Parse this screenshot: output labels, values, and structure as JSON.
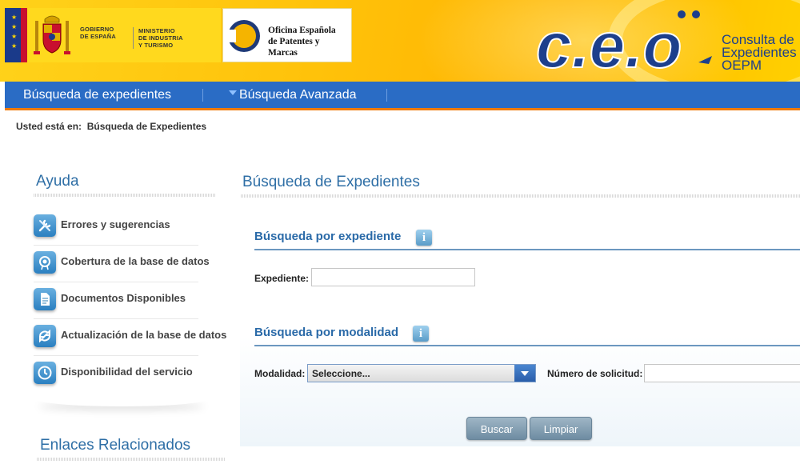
{
  "header": {
    "gov_lines": [
      "GOBIERNO",
      "DE ESPAÑA"
    ],
    "ministry_lines": [
      "MINISTERIO",
      "DE INDUSTRIA",
      "Y TURISMO"
    ],
    "oepm_lines": [
      "Oficina Española",
      "de Patentes y Marcas"
    ],
    "ceo_logo_text": "c.e.o",
    "ceo_sub_lines": [
      "Consulta de",
      "Expedientes",
      "OEPM"
    ],
    "colors": {
      "yellow": "#ffc20a",
      "blue": "#1d3f8c",
      "nav": "#2a6cc5",
      "accent": "#f07a0a"
    }
  },
  "nav": {
    "items": [
      {
        "label": "Búsqueda de expedientes"
      },
      {
        "label": "Búsqueda Avanzada"
      }
    ]
  },
  "breadcrumb": {
    "prefix": "Usted está en:",
    "current": "Búsqueda de Expedientes"
  },
  "sidebar": {
    "title": "Ayuda",
    "items": [
      {
        "label": "Errores y sugerencias",
        "icon": "tools-icon"
      },
      {
        "label": "Cobertura de la base de datos",
        "icon": "coverage-icon"
      },
      {
        "label": "Documentos Disponibles",
        "icon": "document-icon"
      },
      {
        "label": "Actualización de la base de datos",
        "icon": "refresh-icon"
      },
      {
        "label": "Disponibilidad del servicio",
        "icon": "clock-icon"
      }
    ],
    "links_title": "Enlaces Relacionados"
  },
  "main": {
    "title": "Búsqueda de Expedientes",
    "section_expediente": {
      "title": "Búsqueda por expediente",
      "field_label": "Expediente:",
      "field_value": ""
    },
    "section_modalidad": {
      "title": "Búsqueda por modalidad",
      "modalidad_label": "Modalidad:",
      "modalidad_value": "Seleccione...",
      "numero_label": "Número de solicitud:",
      "numero_value": ""
    },
    "buttons": {
      "search": "Buscar",
      "clear": "Limpiar"
    }
  }
}
